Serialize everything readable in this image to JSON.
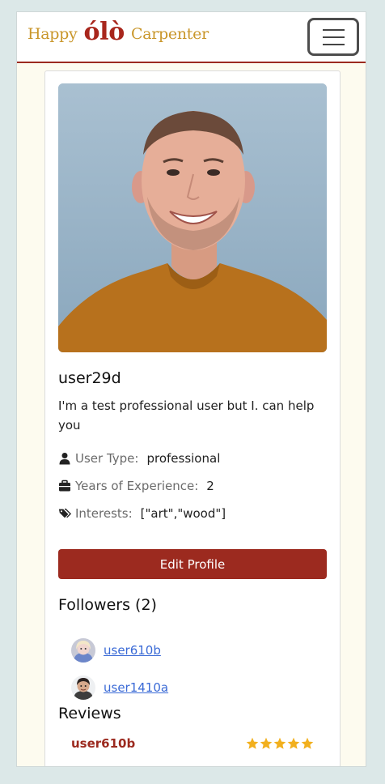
{
  "brand": {
    "left_text": "Happy",
    "logo_text": "ólò",
    "right_text": "Carpenter"
  },
  "nav": {
    "menu_icon": "hamburger-icon"
  },
  "profile": {
    "username": "user29d",
    "bio": "I'm a test professional user but I. can help you",
    "fields": [
      {
        "icon": "user-icon",
        "label": "User Type:",
        "value": "professional"
      },
      {
        "icon": "briefcase-icon",
        "label": "Years of Experience:",
        "value": "2"
      },
      {
        "icon": "tags-icon",
        "label": "Interests:",
        "value": "[\"art\",\"wood\"]"
      }
    ],
    "edit_label": "Edit Profile"
  },
  "followers": {
    "title": "Followers (2)",
    "items": [
      {
        "name": "user610b"
      },
      {
        "name": "user1410a"
      }
    ]
  },
  "reviews": {
    "title": "Reviews",
    "items": [
      {
        "user": "user610b",
        "rating": 5
      }
    ]
  },
  "colors": {
    "accent": "#9c2a1f",
    "brand_gold": "#c9962a",
    "link": "#3a6ad6",
    "star": "#f2b01e"
  }
}
